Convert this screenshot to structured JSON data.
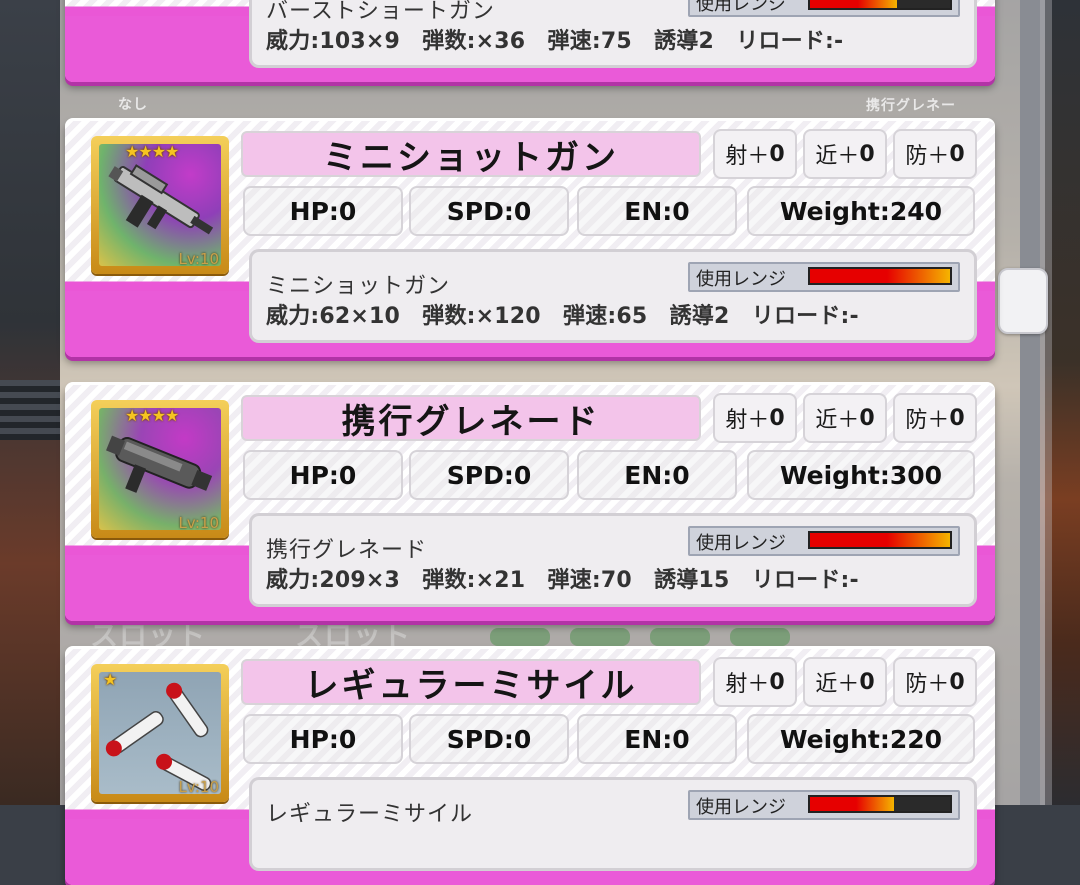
{
  "background": {
    "ghost_labels": [
      "なし",
      "携行グレネー",
      "スロット",
      "スロット"
    ]
  },
  "range_label": "使用レンジ",
  "colors": {
    "name_bg": "#f3c4ea",
    "card_pink": "#ea57d6",
    "range_red": "#e60000",
    "range_yellow": "#f5b400"
  },
  "weapons": [
    {
      "name": "",
      "info_name": "バーストショートガン",
      "info_stats": "威力:103×9　弾数:×36　弾速:75　誘導2　リロード:-",
      "range_fill": 0.62
    },
    {
      "name": "ミニショットガン",
      "stars": "★★★★",
      "level": "Lv:10",
      "icon": "rifle-icon",
      "mods": [
        {
          "label": "射＋",
          "value": "0"
        },
        {
          "label": "近＋",
          "value": "0"
        },
        {
          "label": "防＋",
          "value": "0"
        }
      ],
      "hp": "HP:0",
      "spd": "SPD:0",
      "en": "EN:0",
      "weight": "Weight:240",
      "info_name": "ミニショットガン",
      "info_stats": "威力:62×10　弾数:×120　弾速:65　誘導2　リロード:-",
      "range_fill": 1.0
    },
    {
      "name": "携行グレネード",
      "stars": "★★★★",
      "level": "Lv:10",
      "icon": "grenade-launcher-icon",
      "mods": [
        {
          "label": "射＋",
          "value": "0"
        },
        {
          "label": "近＋",
          "value": "0"
        },
        {
          "label": "防＋",
          "value": "0"
        }
      ],
      "hp": "HP:0",
      "spd": "SPD:0",
      "en": "EN:0",
      "weight": "Weight:300",
      "info_name": "携行グレネード",
      "info_stats": "威力:209×3　弾数:×21　弾速:70　誘導15　リロード:-",
      "range_fill": 1.0
    },
    {
      "name": "レギュラーミサイル",
      "stars": "★",
      "level": "Lv:10",
      "icon": "missile-icon",
      "mods": [
        {
          "label": "射＋",
          "value": "0"
        },
        {
          "label": "近＋",
          "value": "0"
        },
        {
          "label": "防＋",
          "value": "0"
        }
      ],
      "hp": "HP:0",
      "spd": "SPD:0",
      "en": "EN:0",
      "weight": "Weight:220",
      "info_name": "レギュラーミサイル",
      "range_fill": 0.6
    }
  ]
}
